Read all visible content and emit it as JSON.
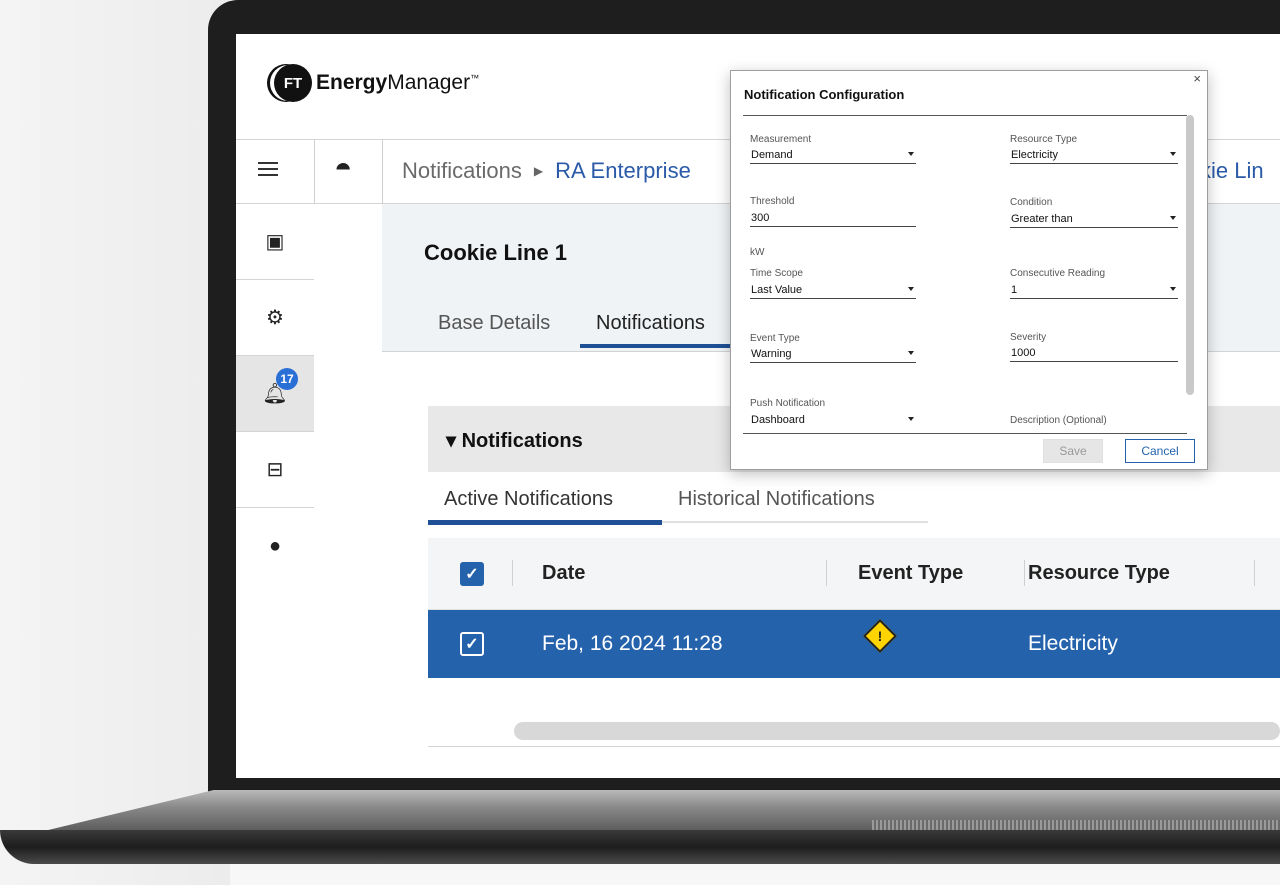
{
  "header": {
    "logo_mark": "FT",
    "logo_text_bold": "Energy",
    "logo_text_rest": "Manager",
    "logo_tm": "™"
  },
  "breadcrumb": {
    "items": [
      "Notifications",
      "RA Enterprise"
    ],
    "tail": "kie Lin"
  },
  "nav": {
    "notification_count": "17"
  },
  "asset": {
    "title": "Cookie Line 1",
    "tabs": [
      "Base Details",
      "Notifications"
    ]
  },
  "notifications": {
    "header": "Notifications",
    "subtabs": [
      "Active Notifications",
      "Historical Notifications"
    ],
    "columns": [
      "Date",
      "Event Type",
      "Resource Type"
    ],
    "rows": [
      {
        "date": "Feb, 16 2024 11:28",
        "event_icon": "warning-icon",
        "resource": "Electricity"
      }
    ]
  },
  "dialog": {
    "title": "Notification Configuration",
    "close": "×",
    "fields": {
      "measurement": {
        "label": "Measurement",
        "value": "Demand"
      },
      "resource_type": {
        "label": "Resource Type",
        "value": "Electricity"
      },
      "threshold": {
        "label": "Threshold",
        "value": "300"
      },
      "condition": {
        "label": "Condition",
        "value": "Greater than"
      },
      "unit": "kW",
      "time_scope": {
        "label": "Time Scope",
        "value": "Last Value"
      },
      "consecutive": {
        "label": "Consecutive Reading",
        "value": "1"
      },
      "event_type": {
        "label": "Event Type",
        "value": "Warning"
      },
      "severity": {
        "label": "Severity",
        "value": "1000"
      },
      "push": {
        "label": "Push Notification",
        "value": "Dashboard"
      },
      "description": {
        "label": "Description (Optional)"
      }
    },
    "save": "Save",
    "cancel": "Cancel"
  },
  "colors": {
    "primary": "#2462ac",
    "badge": "#2a6fd6",
    "warning": "#ffd400"
  }
}
